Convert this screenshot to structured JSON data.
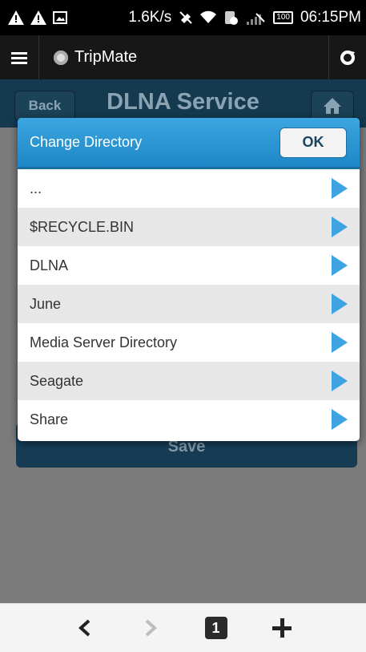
{
  "status_bar": {
    "network_speed": "1.6K/s",
    "battery_level": "100",
    "time": "06:15PM"
  },
  "browser": {
    "title": "TripMate"
  },
  "page": {
    "back_label": "Back",
    "title": "DLNA Service",
    "save_label": "Save"
  },
  "dialog": {
    "title": "Change Directory",
    "ok_label": "OK",
    "items": [
      {
        "label": "..."
      },
      {
        "label": "$RECYCLE.BIN"
      },
      {
        "label": "DLNA"
      },
      {
        "label": "June"
      },
      {
        "label": "Media Server Directory"
      },
      {
        "label": "Seagate"
      },
      {
        "label": "Share"
      }
    ]
  },
  "toolbar": {
    "tab_count": "1"
  },
  "colors": {
    "dialog_header": "#2796d6",
    "arrow": "#3fa3e3",
    "page_header": "#153a50"
  }
}
